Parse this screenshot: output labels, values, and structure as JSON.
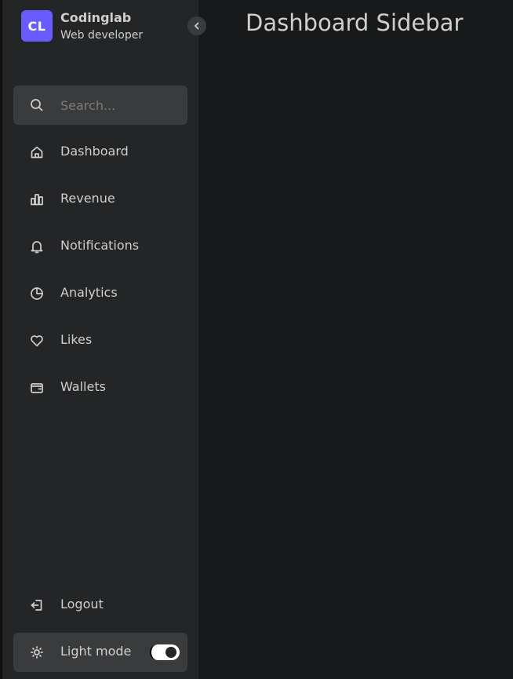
{
  "brand": {
    "logo_text": "CL",
    "name": "Codinglab",
    "subtitle": "Web developer",
    "logo_color": "#695cfe"
  },
  "sidebar_toggle": {
    "icon": "chevron-left-icon"
  },
  "search": {
    "placeholder": "Search...",
    "value": "",
    "icon": "search-icon"
  },
  "nav": {
    "items": [
      {
        "label": "Dashboard",
        "icon": "home-icon"
      },
      {
        "label": "Revenue",
        "icon": "bar-chart-icon"
      },
      {
        "label": "Notifications",
        "icon": "bell-icon"
      },
      {
        "label": "Analytics",
        "icon": "pie-chart-icon"
      },
      {
        "label": "Likes",
        "icon": "heart-icon"
      },
      {
        "label": "Wallets",
        "icon": "wallet-icon"
      }
    ]
  },
  "bottom": {
    "logout_label": "Logout",
    "logout_icon": "logout-icon",
    "mode_label": "Light mode",
    "mode_icon": "sun-icon",
    "mode_toggle_on": true
  },
  "main": {
    "title": "Dashboard Sidebar"
  },
  "colors": {
    "sidebar_bg": "#242526",
    "page_bg": "#18191a",
    "accent": "#695cfe",
    "text": "#cfcfcf",
    "field_bg": "#3a3b3c"
  }
}
